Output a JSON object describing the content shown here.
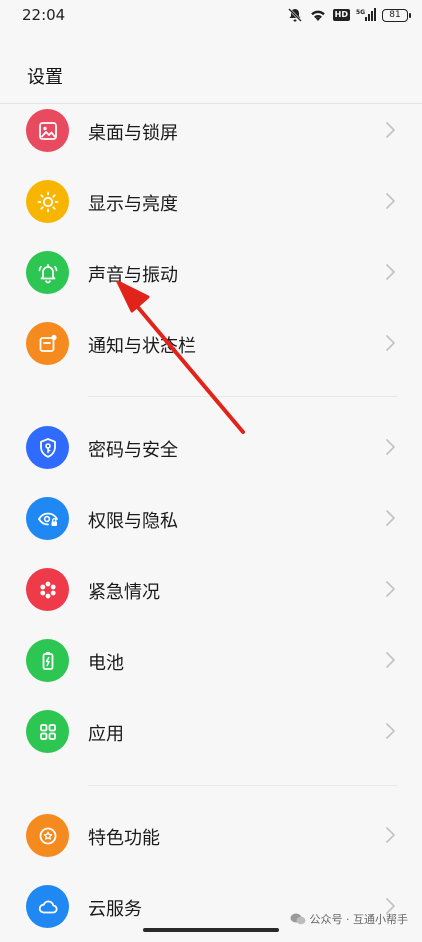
{
  "status_bar": {
    "time": "22:04",
    "hd_label": "HD",
    "signal_label": "5G",
    "battery_level": "81"
  },
  "header": {
    "title": "设置"
  },
  "sections": [
    {
      "items": [
        {
          "label": "桌面与锁屏",
          "icon": "wallpaper-icon",
          "color": "#e84a5f"
        },
        {
          "label": "显示与亮度",
          "icon": "brightness-icon",
          "color": "#f7b500"
        },
        {
          "label": "声音与振动",
          "icon": "bell-icon",
          "color": "#2dc653"
        },
        {
          "label": "通知与状态栏",
          "icon": "notification-icon",
          "color": "#f58a1f"
        }
      ]
    },
    {
      "items": [
        {
          "label": "密码与安全",
          "icon": "shield-key-icon",
          "color": "#2f6bff"
        },
        {
          "label": "权限与隐私",
          "icon": "eye-lock-icon",
          "color": "#1f88f2"
        },
        {
          "label": "紧急情况",
          "icon": "asterisk-icon",
          "color": "#ef3a4a"
        },
        {
          "label": "电池",
          "icon": "battery-icon",
          "color": "#2dc653"
        },
        {
          "label": "应用",
          "icon": "grid-apps-icon",
          "color": "#2dc653"
        }
      ]
    },
    {
      "items": [
        {
          "label": "特色功能",
          "icon": "star-badge-icon",
          "color": "#f58a1f"
        },
        {
          "label": "云服务",
          "icon": "cloud-icon",
          "color": "#1f88f2"
        }
      ]
    }
  ],
  "watermark": {
    "text": "公众号 · 互通小帮手"
  }
}
